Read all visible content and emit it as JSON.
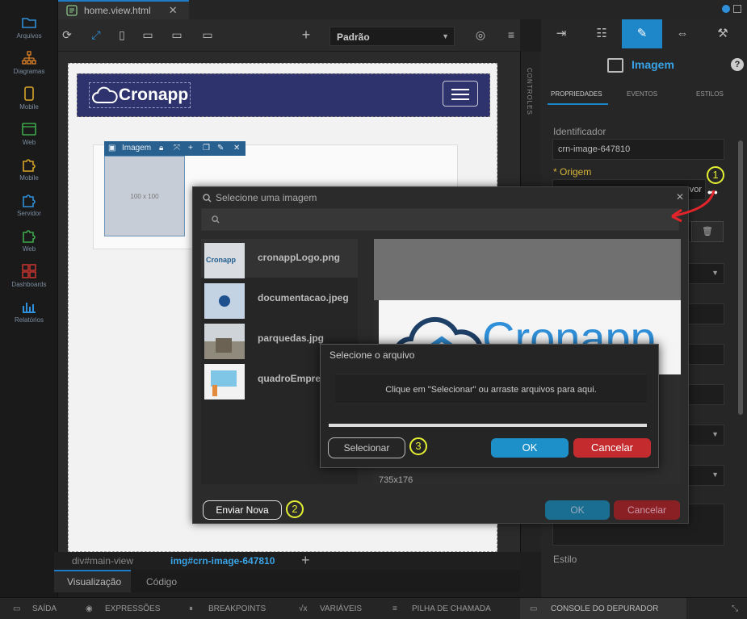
{
  "file_tab": {
    "label": "home.view.html",
    "close": "✕"
  },
  "sidebar": {
    "items": [
      {
        "label": "Arquivos",
        "icon": "folder-icon",
        "color": "#2f8fd8"
      },
      {
        "label": "Diagramas",
        "icon": "diagram-icon",
        "color": "#d87e27"
      },
      {
        "label": "Mobile",
        "icon": "mobile-icon",
        "color": "#d8a427"
      },
      {
        "label": "Web",
        "icon": "web-icon",
        "color": "#3ea84a"
      },
      {
        "label": "Mobile",
        "icon": "puzzle-icon",
        "color": "#d8a427"
      },
      {
        "label": "Servidor",
        "icon": "puzzle-icon",
        "color": "#2f8fd8"
      },
      {
        "label": "Web",
        "icon": "puzzle-icon",
        "color": "#3ea84a"
      },
      {
        "label": "Dashboards",
        "icon": "dashboard-icon",
        "color": "#c9342f"
      },
      {
        "label": "Relatórios",
        "icon": "chart-icon",
        "color": "#2f8fd8"
      }
    ]
  },
  "toolbar": {
    "viewport": "Padrão"
  },
  "canvas": {
    "logo_text": "Cronapp",
    "image_label": "Imagem",
    "placeholder_text": "100 x 100"
  },
  "controls_strip": {
    "label": "CONTROLES"
  },
  "right_panel": {
    "title": "Imagem",
    "tabs": [
      "PROPRIEDADES",
      "EVENTOS",
      "ESTILOS"
    ],
    "identificador_label": "Identificador",
    "identificador_value": "crn-image-647810",
    "origem_label": "* Origem",
    "origem_partial": "vor",
    "estilo_label": "Estilo",
    "accent": "#1d87c9"
  },
  "breadcrumb": {
    "parent": "div#main-view",
    "current": "img#crn-image-647810"
  },
  "bottom_tabs": {
    "visualizacao": "Visualização",
    "codigo": "Código"
  },
  "status_bar": {
    "items": [
      "SAÍDA",
      "EXPRESSÕES",
      "BREAKPOINTS",
      "VARIÁVEIS",
      "PILHA DE CHAMADA",
      "CONSOLE DO DEPURADOR"
    ]
  },
  "image_dialog": {
    "title": "Selecione uma imagem",
    "close": "✕",
    "files": [
      {
        "name": "cronappLogo.png"
      },
      {
        "name": "documentacao.jpeg"
      },
      {
        "name": "parquedas.jpg"
      },
      {
        "name": "quadroEmpre"
      }
    ],
    "preview_text": "Cronapp",
    "preview_size": "735x176",
    "enviar_nova": "Enviar Nova",
    "ok": "OK",
    "cancel": "Cancelar"
  },
  "upload_dialog": {
    "title": "Selecione o arquivo",
    "drop_text": "Clique em \"Selecionar\" ou arraste arquivos para aqui.",
    "selecionar": "Selecionar",
    "ok": "OK",
    "cancel": "Cancelar"
  },
  "annotations": {
    "one": "1",
    "two": "2",
    "three": "3",
    "color": "#e4f032"
  }
}
